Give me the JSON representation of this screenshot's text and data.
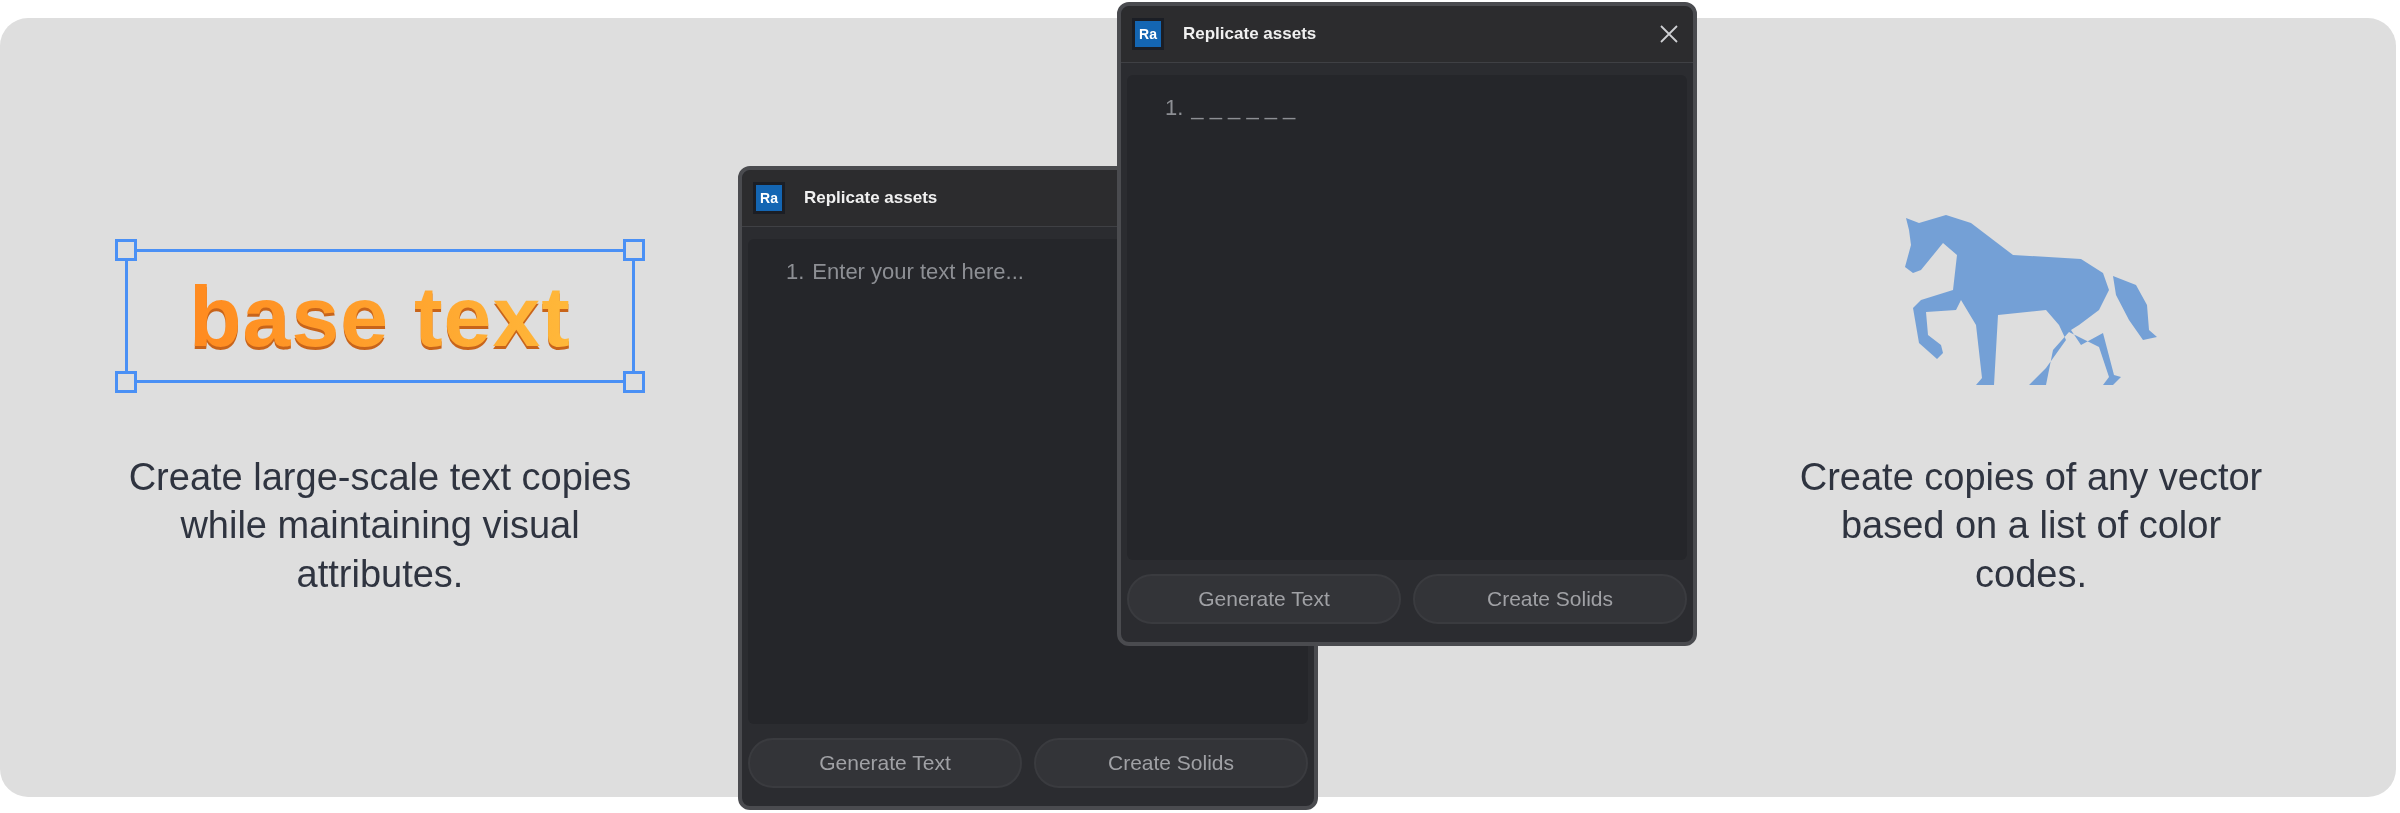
{
  "features": [
    {
      "kind": "text",
      "sample": "base text",
      "caption": "Create large-scale text copies while maintaining visual attributes."
    },
    {
      "kind": "vector",
      "caption": "Create copies of any vector based on a list of color codes."
    }
  ],
  "windows": [
    {
      "logo": "Ra",
      "title": "Replicate assets",
      "line_number": "1.",
      "placeholder": "Enter your text here...",
      "buttons": [
        "Generate Text",
        "Create Solids"
      ]
    },
    {
      "logo": "Ra",
      "title": "Replicate assets",
      "line_number": "1.",
      "value": "_ _ _ _ _ _",
      "buttons": [
        "Generate Text",
        "Create Solids"
      ]
    }
  ]
}
